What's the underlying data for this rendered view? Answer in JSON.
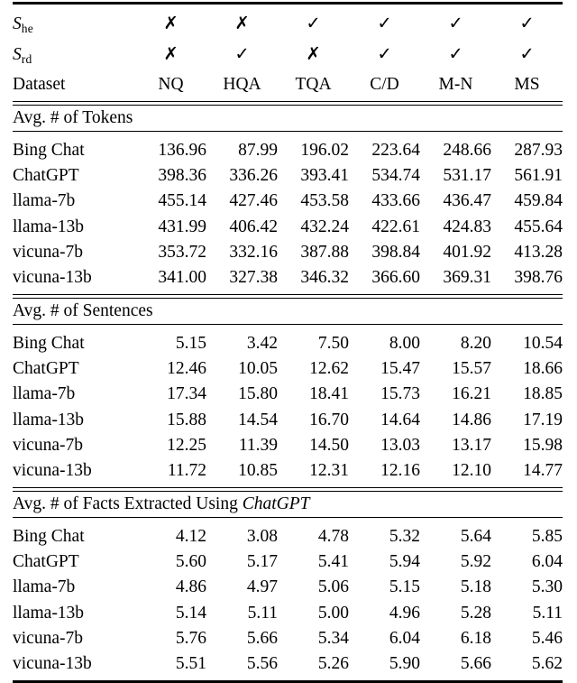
{
  "table": {
    "header": {
      "row_she": {
        "label_base": "S",
        "label_sub": "he",
        "marks": [
          "✗",
          "✗",
          "✓",
          "✓",
          "✓",
          "✓"
        ]
      },
      "row_srd": {
        "label_base": "S",
        "label_sub": "rd",
        "marks": [
          "✗",
          "✓",
          "✗",
          "✓",
          "✓",
          "✓"
        ]
      },
      "row_dataset": {
        "label": "Dataset",
        "columns": [
          "NQ",
          "HQA",
          "TQA",
          "C/D",
          "M-N",
          "MS"
        ]
      }
    },
    "sections": [
      {
        "title": "Avg. # of Tokens",
        "title_italic_suffix": "",
        "rows": [
          {
            "model": "Bing Chat",
            "values": [
              "136.96",
              "87.99",
              "196.02",
              "223.64",
              "248.66",
              "287.93"
            ]
          },
          {
            "model": "ChatGPT",
            "values": [
              "398.36",
              "336.26",
              "393.41",
              "534.74",
              "531.17",
              "561.91"
            ]
          },
          {
            "model": "llama-7b",
            "values": [
              "455.14",
              "427.46",
              "453.58",
              "433.66",
              "436.47",
              "459.84"
            ]
          },
          {
            "model": "llama-13b",
            "values": [
              "431.99",
              "406.42",
              "432.24",
              "422.61",
              "424.83",
              "455.64"
            ]
          },
          {
            "model": "vicuna-7b",
            "values": [
              "353.72",
              "332.16",
              "387.88",
              "398.84",
              "401.92",
              "413.28"
            ]
          },
          {
            "model": "vicuna-13b",
            "values": [
              "341.00",
              "327.38",
              "346.32",
              "366.60",
              "369.31",
              "398.76"
            ]
          }
        ]
      },
      {
        "title": "Avg. # of Sentences",
        "title_italic_suffix": "",
        "rows": [
          {
            "model": "Bing Chat",
            "values": [
              "5.15",
              "3.42",
              "7.50",
              "8.00",
              "8.20",
              "10.54"
            ]
          },
          {
            "model": "ChatGPT",
            "values": [
              "12.46",
              "10.05",
              "12.62",
              "15.47",
              "15.57",
              "18.66"
            ]
          },
          {
            "model": "llama-7b",
            "values": [
              "17.34",
              "15.80",
              "18.41",
              "15.73",
              "16.21",
              "18.85"
            ]
          },
          {
            "model": "llama-13b",
            "values": [
              "15.88",
              "14.54",
              "16.70",
              "14.64",
              "14.86",
              "17.19"
            ]
          },
          {
            "model": "vicuna-7b",
            "values": [
              "12.25",
              "11.39",
              "14.50",
              "13.03",
              "13.17",
              "15.98"
            ]
          },
          {
            "model": "vicuna-13b",
            "values": [
              "11.72",
              "10.85",
              "12.31",
              "12.16",
              "12.10",
              "14.77"
            ]
          }
        ]
      },
      {
        "title": "Avg. # of Facts Extracted Using ",
        "title_italic_suffix": "ChatGPT",
        "rows": [
          {
            "model": "Bing Chat",
            "values": [
              "4.12",
              "3.08",
              "4.78",
              "5.32",
              "5.64",
              "5.85"
            ]
          },
          {
            "model": "ChatGPT",
            "values": [
              "5.60",
              "5.17",
              "5.41",
              "5.94",
              "5.92",
              "6.04"
            ]
          },
          {
            "model": "llama-7b",
            "values": [
              "4.86",
              "4.97",
              "5.06",
              "5.15",
              "5.18",
              "5.30"
            ]
          },
          {
            "model": "llama-13b",
            "values": [
              "5.14",
              "5.11",
              "5.00",
              "4.96",
              "5.28",
              "5.11"
            ]
          },
          {
            "model": "vicuna-7b",
            "values": [
              "5.76",
              "5.66",
              "5.34",
              "6.04",
              "6.18",
              "5.46"
            ]
          },
          {
            "model": "vicuna-13b",
            "values": [
              "5.51",
              "5.56",
              "5.26",
              "5.90",
              "5.66",
              "5.62"
            ]
          }
        ]
      }
    ]
  }
}
